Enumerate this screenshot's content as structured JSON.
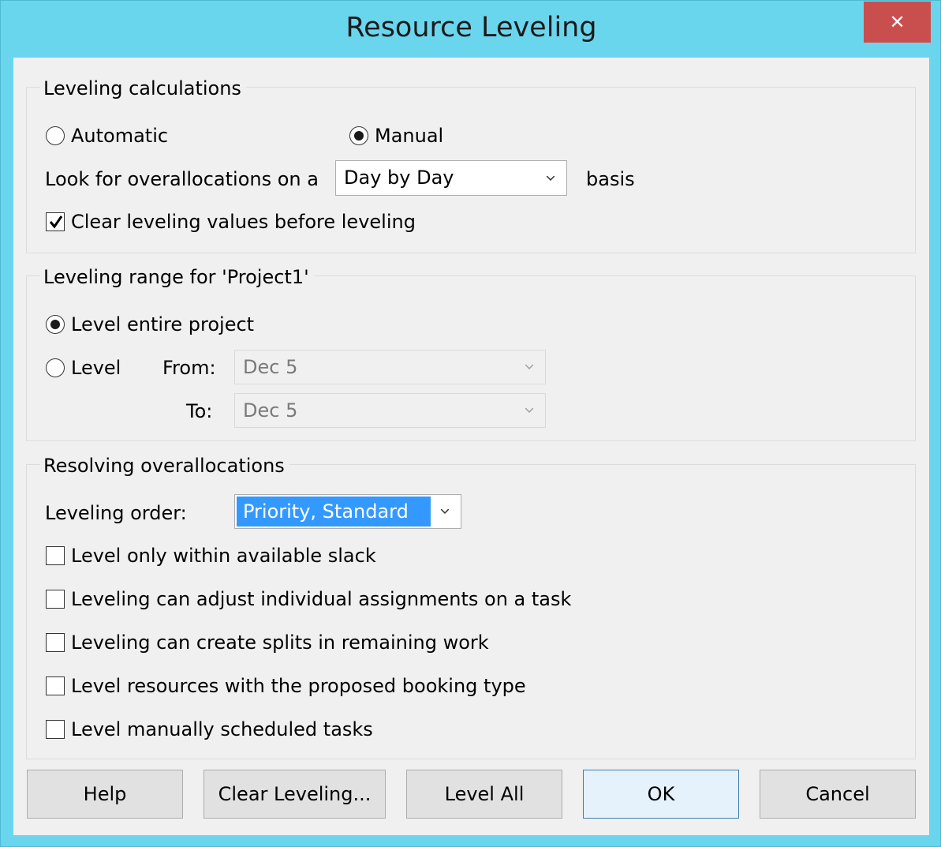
{
  "window": {
    "title": "Resource Leveling",
    "close_glyph": "✕"
  },
  "calc": {
    "group_label": "Leveling calculations",
    "automatic_label": "Automatic",
    "automatic_selected": false,
    "manual_label": "Manual",
    "manual_selected": true,
    "overalloc_prefix": "Look for overallocations on a",
    "basis_value": "Day by Day",
    "basis_suffix": "basis",
    "clear_values_label": "Clear leveling values before leveling",
    "clear_values_checked": true
  },
  "range": {
    "group_label": "Leveling range for 'Project1'",
    "entire_label": "Level entire project",
    "entire_selected": true,
    "level_label": "Level",
    "from_label": "From:",
    "from_value": "Dec 5",
    "to_label": "To:",
    "to_value": "Dec 5"
  },
  "resolve": {
    "group_label": "Resolving overallocations",
    "order_label": "Leveling order:",
    "order_value": "Priority, Standard",
    "options": [
      {
        "label": "Level only within available slack",
        "checked": false
      },
      {
        "label": "Leveling can adjust individual assignments on a task",
        "checked": false
      },
      {
        "label": "Leveling can create splits in remaining work",
        "checked": false
      },
      {
        "label": "Level resources with the proposed booking type",
        "checked": false
      },
      {
        "label": "Level manually scheduled tasks",
        "checked": false
      }
    ]
  },
  "buttons": {
    "help": "Help",
    "clear_leveling": "Clear Leveling...",
    "level_all": "Level All",
    "ok": "OK",
    "cancel": "Cancel"
  },
  "icons": {
    "close": "close-icon",
    "dropdown": "chevron-down-icon",
    "check": "checkmark-icon"
  }
}
